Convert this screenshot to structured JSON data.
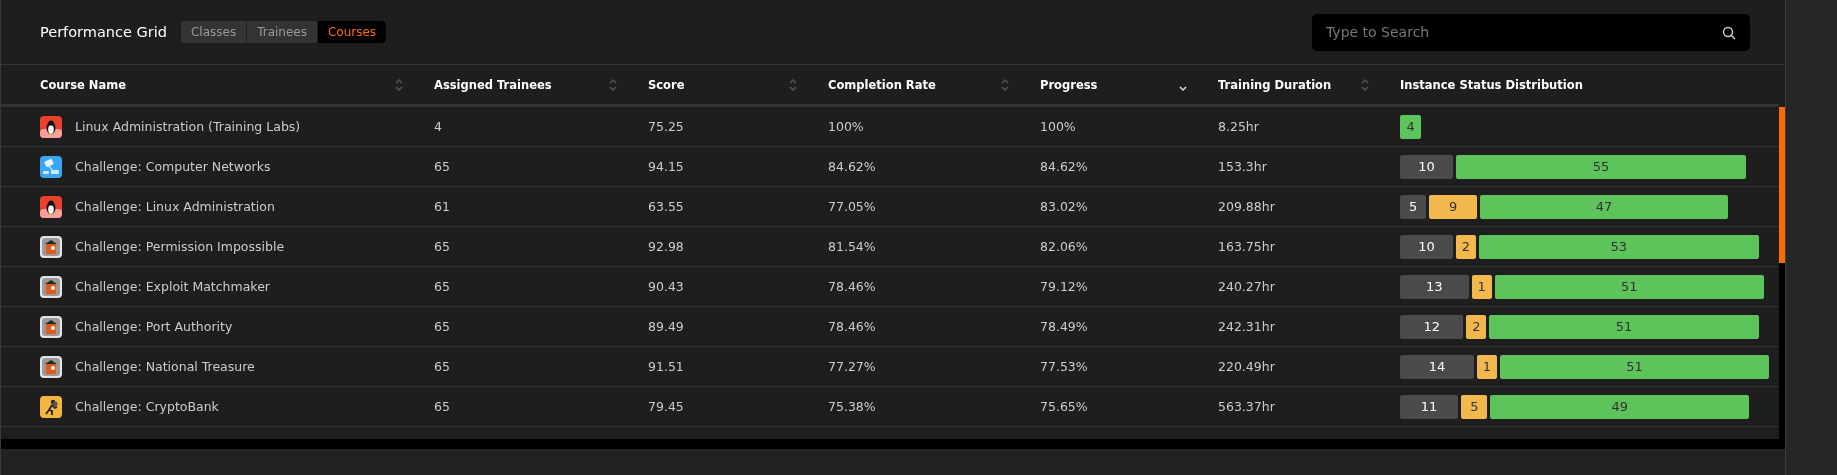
{
  "header": {
    "title": "Performance Grid",
    "tabs": [
      {
        "label": "Classes",
        "selected": false
      },
      {
        "label": "Trainees",
        "selected": false
      },
      {
        "label": "Courses",
        "selected": true
      }
    ],
    "search": {
      "placeholder": "Type to Search"
    }
  },
  "table": {
    "columns": [
      {
        "label": "Course Name",
        "sorted": false
      },
      {
        "label": "Assigned Trainees",
        "sorted": false
      },
      {
        "label": "Score",
        "sorted": false
      },
      {
        "label": "Completion Rate",
        "sorted": false
      },
      {
        "label": "Progress",
        "sorted": true
      },
      {
        "label": "Training Duration",
        "sorted": false
      },
      {
        "label": "Instance Status Distribution"
      }
    ],
    "rows": [
      {
        "kind": "penguin",
        "name": "Linux Administration (Training Labs)",
        "assigned": "4",
        "score": "75.25",
        "completion": "100%",
        "progress": "100%",
        "duration": "8.25hr",
        "distribution": [
          {
            "kind": "green",
            "value": "4"
          }
        ]
      },
      {
        "kind": "network",
        "name": "Challenge: Computer Networks",
        "assigned": "65",
        "score": "94.15",
        "completion": "84.62%",
        "progress": "84.62%",
        "duration": "153.3hr",
        "distribution": [
          {
            "kind": "grey",
            "value": "10"
          },
          {
            "kind": "green",
            "value": "55"
          }
        ]
      },
      {
        "kind": "penguin",
        "name": "Challenge: Linux Administration",
        "assigned": "61",
        "score": "63.55",
        "completion": "77.05%",
        "progress": "83.02%",
        "duration": "209.88hr",
        "distribution": [
          {
            "kind": "grey",
            "value": "5"
          },
          {
            "kind": "yellow",
            "value": "9"
          },
          {
            "kind": "green",
            "value": "47"
          }
        ]
      },
      {
        "kind": "box",
        "name": "Challenge: Permission Impossible",
        "assigned": "65",
        "score": "92.98",
        "completion": "81.54%",
        "progress": "82.06%",
        "duration": "163.75hr",
        "distribution": [
          {
            "kind": "grey",
            "value": "10"
          },
          {
            "kind": "yellow",
            "value": "2"
          },
          {
            "kind": "green",
            "value": "53"
          }
        ]
      },
      {
        "kind": "box",
        "name": "Challenge: Exploit Matchmaker",
        "assigned": "65",
        "score": "90.43",
        "completion": "78.46%",
        "progress": "79.12%",
        "duration": "240.27hr",
        "distribution": [
          {
            "kind": "grey",
            "value": "13"
          },
          {
            "kind": "yellow",
            "value": "1"
          },
          {
            "kind": "green",
            "value": "51"
          }
        ]
      },
      {
        "kind": "box",
        "name": "Challenge: Port Authority",
        "assigned": "65",
        "score": "89.49",
        "completion": "78.46%",
        "progress": "78.49%",
        "duration": "242.31hr",
        "distribution": [
          {
            "kind": "grey",
            "value": "12"
          },
          {
            "kind": "yellow",
            "value": "2"
          },
          {
            "kind": "green",
            "value": "51"
          }
        ]
      },
      {
        "kind": "box",
        "name": "Challenge: National Treasure",
        "assigned": "65",
        "score": "91.51",
        "completion": "77.27%",
        "progress": "77.53%",
        "duration": "220.49hr",
        "distribution": [
          {
            "kind": "grey",
            "value": "14"
          },
          {
            "kind": "yellow",
            "value": "1"
          },
          {
            "kind": "green",
            "value": "51"
          }
        ]
      },
      {
        "kind": "runner",
        "name": "Challenge: CryptoBank",
        "assigned": "65",
        "score": "79.45",
        "completion": "75.38%",
        "progress": "75.65%",
        "duration": "563.37hr",
        "distribution": [
          {
            "kind": "grey",
            "value": "11"
          },
          {
            "kind": "yellow",
            "value": "5"
          },
          {
            "kind": "green",
            "value": "49"
          }
        ]
      }
    ]
  }
}
